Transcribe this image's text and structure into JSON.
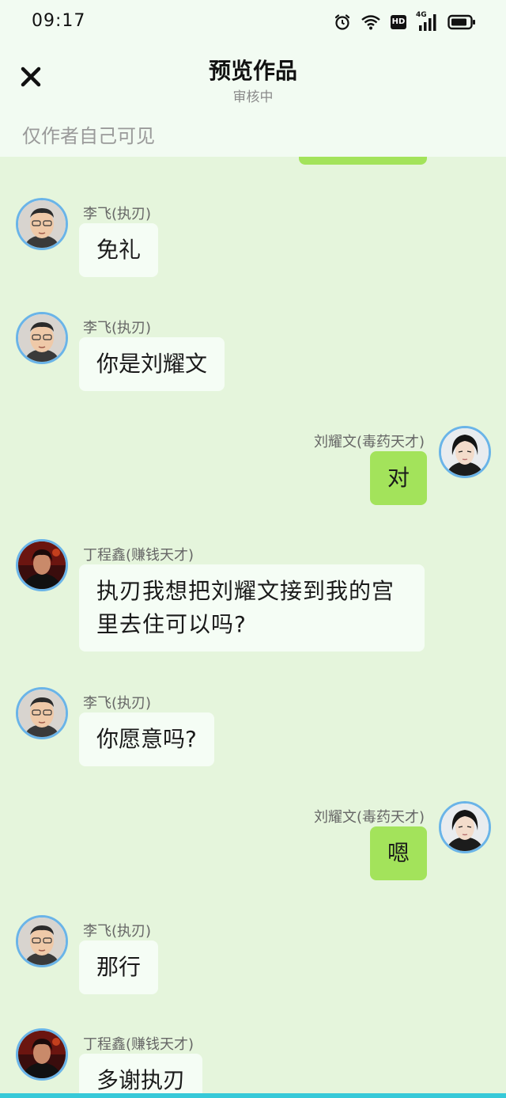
{
  "status_bar": {
    "time": "09:17",
    "icons": [
      "alarm-icon",
      "wifi-icon",
      "hd-icon",
      "signal-4g-icon",
      "battery-icon"
    ],
    "hd_label": "HD",
    "network_label": "4G"
  },
  "header": {
    "title": "预览作品",
    "subtitle": "审核中",
    "visibility_note": "仅作者自己可见",
    "close_icon": "close-icon"
  },
  "colors": {
    "background": "#e5f5dc",
    "header_background": "#f2fbf2",
    "incoming_bubble": "#f5fdf5",
    "outgoing_bubble": "#a3e35b",
    "avatar_border": "#6ab4e8"
  },
  "messages": [
    {
      "side": "left",
      "avatar": "li-fei-avatar",
      "name": "李飞(执刃)",
      "text": "免礼"
    },
    {
      "side": "left",
      "avatar": "li-fei-avatar",
      "name": "李飞(执刃)",
      "text": "你是刘耀文"
    },
    {
      "side": "right",
      "avatar": "liu-yaowen-avatar",
      "name": "刘耀文(毒药天才)",
      "text": "对"
    },
    {
      "side": "left",
      "avatar": "ding-chengxin-avatar",
      "name": "丁程鑫(赚钱天才)",
      "text": "执刃我想把刘耀文接到我的宫里去住可以吗?"
    },
    {
      "side": "left",
      "avatar": "li-fei-avatar",
      "name": "李飞(执刃)",
      "text": "你愿意吗?"
    },
    {
      "side": "right",
      "avatar": "liu-yaowen-avatar",
      "name": "刘耀文(毒药天才)",
      "text": "嗯"
    },
    {
      "side": "left",
      "avatar": "li-fei-avatar",
      "name": "李飞(执刃)",
      "text": "那行"
    },
    {
      "side": "left",
      "avatar": "ding-chengxin-avatar",
      "name": "丁程鑫(赚钱天才)",
      "text": "多谢执刃"
    }
  ]
}
